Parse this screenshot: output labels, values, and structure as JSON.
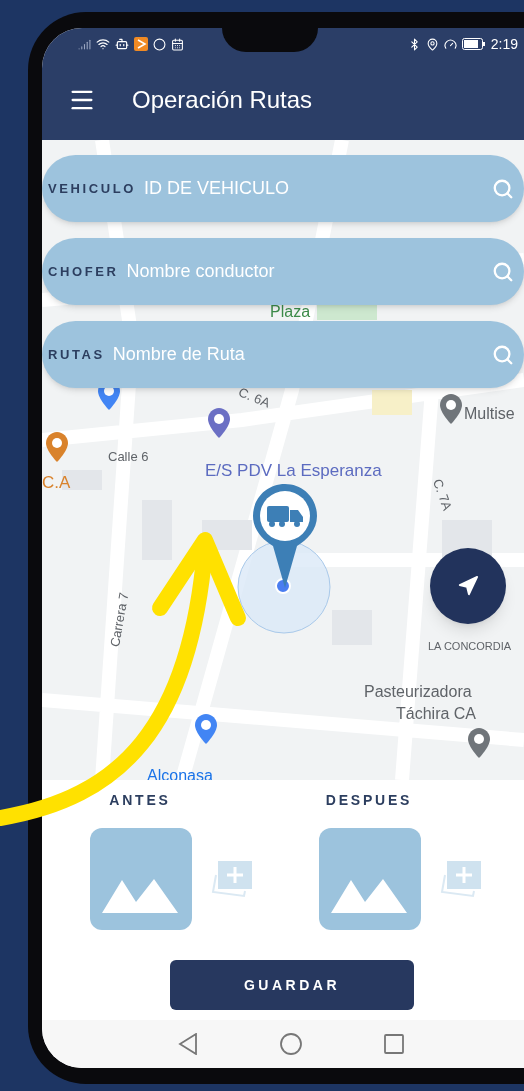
{
  "status_bar": {
    "time": "2:19"
  },
  "app_bar": {
    "title": "Operación Rutas"
  },
  "search_fields": [
    {
      "label": "VEHICULO",
      "placeholder": "ID DE VEHICULO"
    },
    {
      "label": "CHOFER",
      "placeholder": "Nombre conductor"
    },
    {
      "label": "RUTAS",
      "placeholder": "Nombre de Ruta"
    }
  ],
  "map": {
    "labels": [
      {
        "text": "Plaza",
        "kind": "park"
      },
      {
        "text": "C. 6A",
        "kind": "street"
      },
      {
        "text": "Calle 6",
        "kind": "street"
      },
      {
        "text": "C.A",
        "kind": "food"
      },
      {
        "text": "E/S PDV La Esperanza",
        "kind": "poi"
      },
      {
        "text": "Multise",
        "kind": "place"
      },
      {
        "text": "C. 7A",
        "kind": "street"
      },
      {
        "text": "Carrera 7",
        "kind": "street"
      },
      {
        "text": "LA CONCORDIA",
        "kind": "area"
      },
      {
        "text": "Pasteurizadora",
        "kind": "place"
      },
      {
        "text": "Táchira CA",
        "kind": "place"
      },
      {
        "text": "Alconasa",
        "kind": "shop"
      }
    ]
  },
  "photos": [
    {
      "label": "ANTES"
    },
    {
      "label": "DESPUES"
    }
  ],
  "save_button": {
    "label": "GUARDAR"
  }
}
